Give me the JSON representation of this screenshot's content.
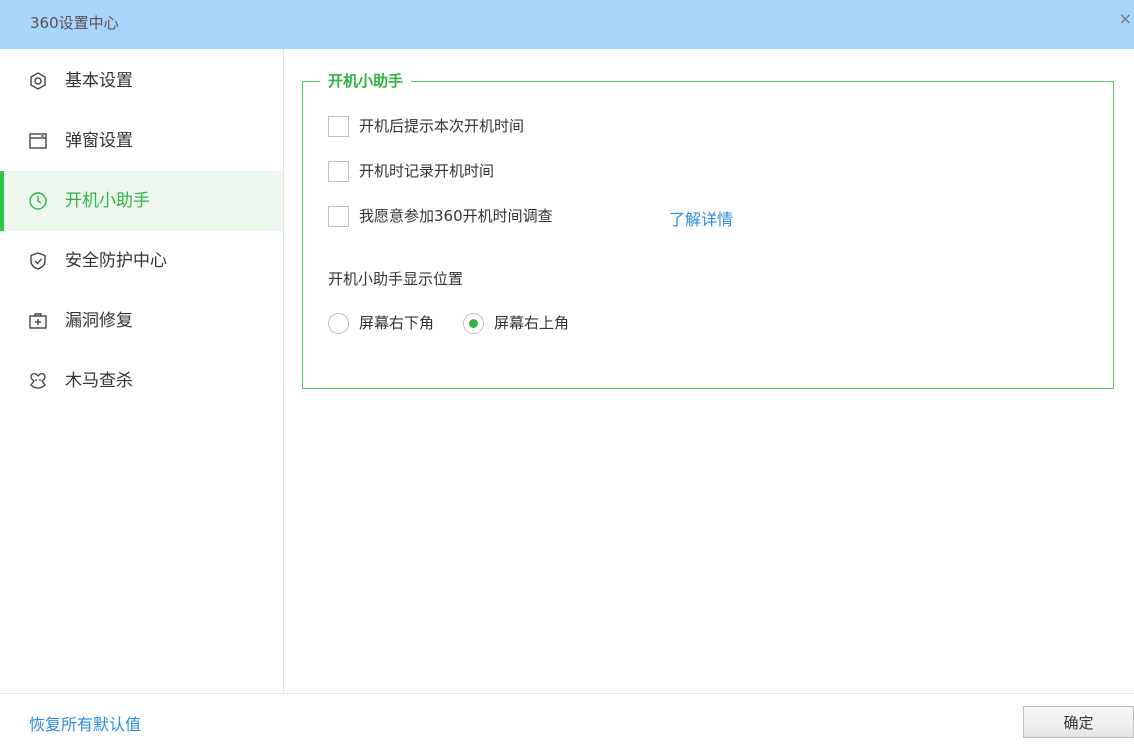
{
  "window": {
    "title": "360设置中心",
    "close_glyph": "×"
  },
  "sidebar": {
    "items": [
      {
        "label": "基本设置",
        "icon": "settings-icon",
        "active": false
      },
      {
        "label": "弹窗设置",
        "icon": "window-icon",
        "active": false
      },
      {
        "label": "开机小助手",
        "icon": "clock-icon",
        "active": true
      },
      {
        "label": "安全防护中心",
        "icon": "shield-icon",
        "active": false
      },
      {
        "label": "漏洞修复",
        "icon": "patch-icon",
        "active": false
      },
      {
        "label": "木马查杀",
        "icon": "trojan-icon",
        "active": false
      }
    ]
  },
  "main": {
    "group_title": "开机小助手",
    "checkboxes": [
      {
        "label": "开机后提示本次开机时间",
        "checked": false
      },
      {
        "label": "开机时记录开机时间",
        "checked": false
      },
      {
        "label": "我愿意参加360开机时间调查",
        "checked": false
      }
    ],
    "learn_more": "了解详情",
    "position_label": "开机小助手显示位置",
    "position_options": [
      {
        "label": "屏幕右下角",
        "checked": false
      },
      {
        "label": "屏幕右上角",
        "checked": true
      }
    ]
  },
  "footer": {
    "restore_defaults": "恢复所有默认值",
    "ok_label": "确定"
  },
  "colors": {
    "titlebar_bg": "#a9d4fb",
    "accent_green": "#2fb344",
    "link_blue": "#2a8be2",
    "active_item_bg": "#eef8ee"
  }
}
